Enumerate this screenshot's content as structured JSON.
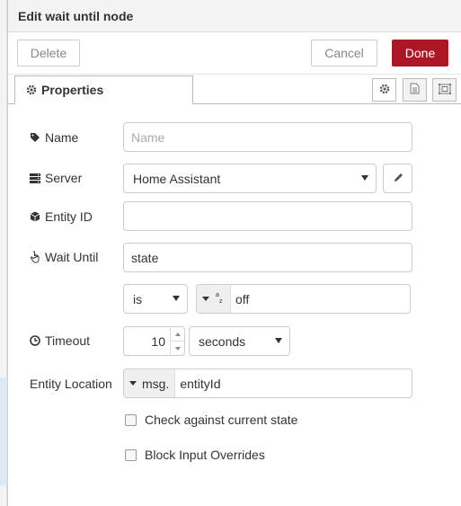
{
  "header": {
    "title": "Edit wait until node"
  },
  "buttons": {
    "delete": "Delete",
    "cancel": "Cancel",
    "done": "Done"
  },
  "tabs": {
    "properties": "Properties"
  },
  "form": {
    "name": {
      "label": "Name",
      "placeholder": "Name",
      "value": ""
    },
    "server": {
      "label": "Server",
      "value": "Home Assistant"
    },
    "entity_id": {
      "label": "Entity ID",
      "value": ""
    },
    "wait_until": {
      "label": "Wait Until",
      "value": "state"
    },
    "comparator": {
      "value": "is"
    },
    "compare_value": {
      "value": "off"
    },
    "timeout": {
      "label": "Timeout",
      "value": "10",
      "unit": "seconds"
    },
    "entity_location": {
      "label": "Entity Location",
      "prefix": "msg.",
      "value": "entityId"
    },
    "check_current_state": {
      "label": "Check against current state",
      "checked": false
    },
    "block_input_overrides": {
      "label": "Block Input Overrides",
      "checked": false
    }
  },
  "colors": {
    "done_button": "#ad1625",
    "header_bg": "#f3f3f3"
  }
}
